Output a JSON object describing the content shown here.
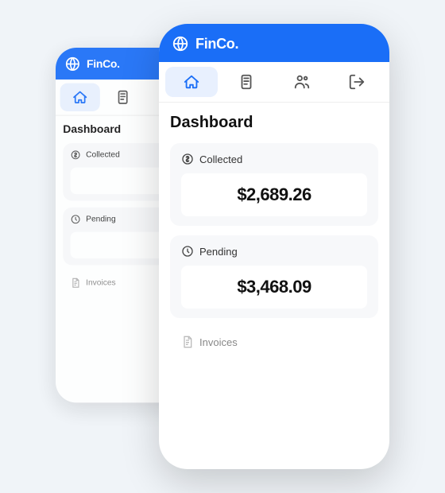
{
  "app": {
    "name": "FinCo.",
    "brand_color": "#1a6ef7"
  },
  "nav": {
    "items": [
      {
        "id": "home",
        "label": "Home",
        "active": true
      },
      {
        "id": "documents",
        "label": "Documents",
        "active": false
      },
      {
        "id": "users",
        "label": "Users",
        "active": false
      },
      {
        "id": "logout",
        "label": "Logout",
        "active": false
      }
    ]
  },
  "dashboard": {
    "title": "Dashboard",
    "cards": [
      {
        "id": "collected",
        "label": "Collected",
        "value": "$2,689.26",
        "icon": "dollar-circle"
      },
      {
        "id": "pending",
        "label": "Pending",
        "value": "$3,468.09",
        "icon": "clock-circle"
      }
    ],
    "bottom_nav": {
      "label": "Invoices",
      "icon": "document"
    }
  }
}
